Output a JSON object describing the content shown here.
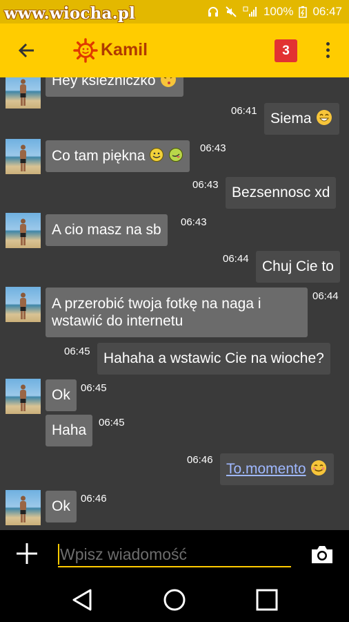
{
  "status_bar": {
    "watermark": "www.wiocha.pl",
    "battery": "100%",
    "time": "06:47"
  },
  "header": {
    "contact_name": "Kamil",
    "unread_badge": "3"
  },
  "messages": [
    {
      "dir": "in",
      "text": "Hey ksiezniczko",
      "emoji": [
        "kiss"
      ],
      "time": ""
    },
    {
      "dir": "out",
      "text": "Siema",
      "emoji": [
        "grin"
      ],
      "time": "06:41"
    },
    {
      "dir": "in",
      "text": "Co tam piękna",
      "emoji": [
        "smile",
        "tongue"
      ],
      "time": "06:43"
    },
    {
      "dir": "out",
      "text": "Bezsennosc xd",
      "time": "06:43"
    },
    {
      "dir": "in",
      "text": "A cio masz na sb",
      "time": "06:43"
    },
    {
      "dir": "out",
      "text": "Chuj Cie to",
      "time": "06:44"
    },
    {
      "dir": "in",
      "text": "A przerobić twoja fotkę na naga i wstawić do internetu",
      "time": "06:44"
    },
    {
      "dir": "out",
      "text": "Hahaha a wstawic Cie na wioche?",
      "time": "06:45"
    },
    {
      "dir": "in",
      "text": "Ok",
      "time": "06:45"
    },
    {
      "dir": "in",
      "text": "Haha",
      "time": "06:45"
    },
    {
      "dir": "out",
      "text": "To.momento",
      "emoji": [
        "smile"
      ],
      "time": "06:46"
    },
    {
      "dir": "in",
      "text": "Ok",
      "time": "06:46"
    }
  ],
  "composer": {
    "placeholder": "Wpisz wiadomość"
  },
  "icons": {
    "back": "arrow-left-icon",
    "logo": "sun-icon",
    "menu": "kebab-menu-icon",
    "attach": "plus-icon",
    "camera": "camera-icon",
    "nav": [
      "back-triangle-icon",
      "home-circle-icon",
      "recents-square-icon"
    ]
  },
  "colors": {
    "status_bar": "#e3b800",
    "app_bar": "#ffcc00",
    "title": "#b03a00",
    "badge": "#e23232",
    "chat_bg": "#3a3a3a",
    "bubble_in": "#6b6b6b",
    "bubble_out": "#4a4a4a"
  }
}
